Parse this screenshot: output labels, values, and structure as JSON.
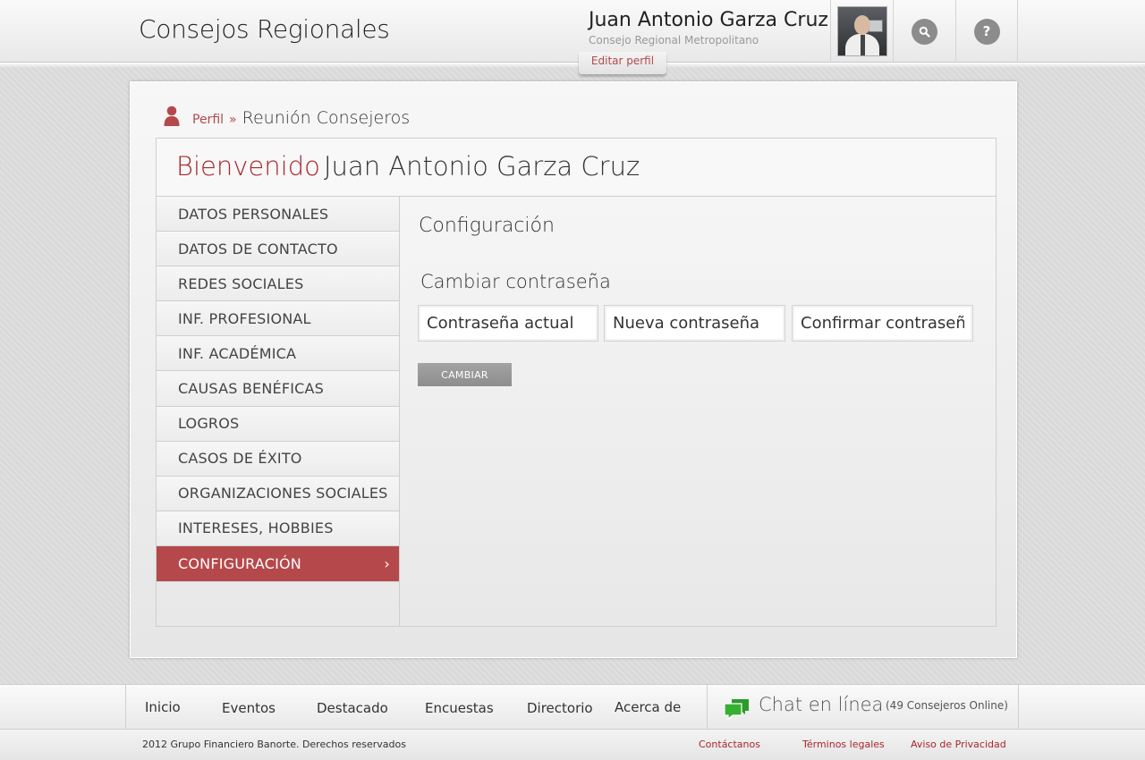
{
  "header": {
    "site_title": "Consejos Regionales",
    "user_name": "Juan Antonio Garza Cruz",
    "user_council": "Consejo Regional Metropolitano",
    "edit_profile": "Editar perfil",
    "help_symbol": "?"
  },
  "breadcrumb": {
    "link": "Perfil",
    "separator": "»",
    "current": "Reunión Consejeros"
  },
  "welcome": {
    "label": "Bienvenido",
    "name": "Juan Antonio Garza Cruz"
  },
  "sidebar": {
    "items": [
      {
        "label": "DATOS PERSONALES"
      },
      {
        "label": "DATOS DE CONTACTO"
      },
      {
        "label": "REDES SOCIALES"
      },
      {
        "label": "INF. PROFESIONAL"
      },
      {
        "label": "INF. ACADÉMICA"
      },
      {
        "label": "CAUSAS BENÉFICAS"
      },
      {
        "label": "LOGROS"
      },
      {
        "label": "CASOS DE ÉXITO"
      },
      {
        "label": "ORGANIZACIONES SOCIALES"
      },
      {
        "label": "INTERESES, HOBBIES"
      },
      {
        "label": "CONFIGURACIÓN",
        "active": true
      }
    ],
    "active_chevron": "›"
  },
  "main": {
    "section_title": "Configuración",
    "subsection_title": "Cambiar contraseña",
    "current_password_placeholder": "Contraseña actual",
    "new_password_placeholder": "Nueva contraseña",
    "confirm_password_placeholder": "Confirmar contraseña",
    "submit_label": "CAMBIAR"
  },
  "footer": {
    "nav": [
      "Inicio",
      "Eventos",
      "Destacado",
      "Encuestas",
      "Directorio",
      "Acerca de"
    ],
    "chat_label": "Chat en línea",
    "online_count": "(49 Consejeros Online)",
    "copyright": "2012 Grupo Financiero Banorte. Derechos reservados",
    "links": [
      "Contáctanos",
      "Términos legales",
      "Aviso de Privacidad"
    ]
  },
  "colors": {
    "accent": "#b5484b",
    "accent_dark": "#a8262c",
    "chat_green": "#2e9a2a"
  },
  "icons": [
    "person-icon",
    "search-icon",
    "help-icon",
    "chat-icon",
    "chevron-right-icon"
  ]
}
